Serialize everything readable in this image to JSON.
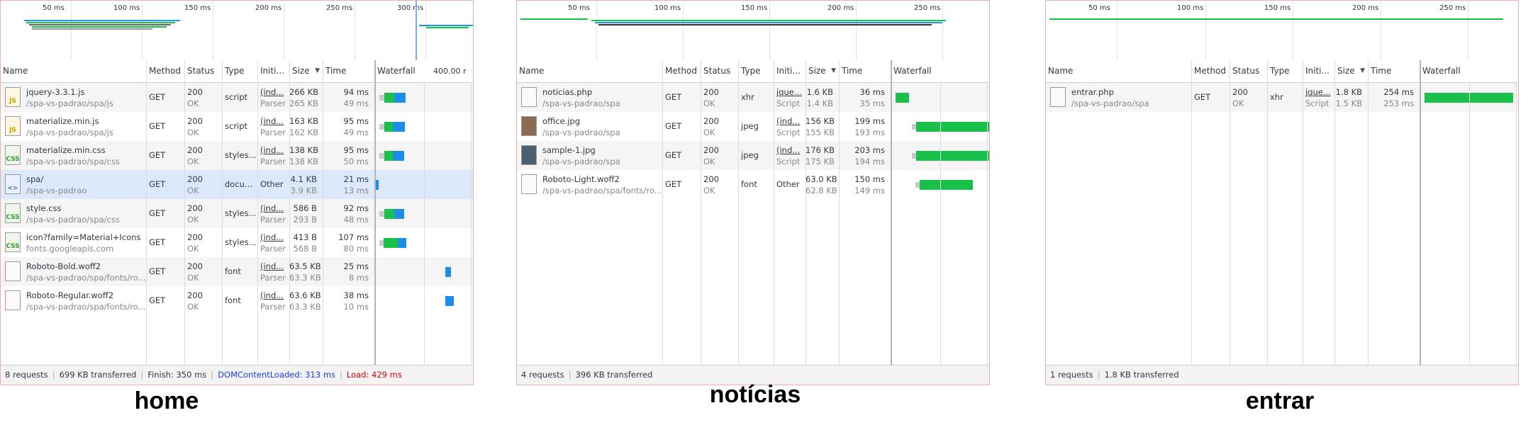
{
  "captions": {
    "home": "home",
    "noticias": "notícias",
    "entrar": "entrar"
  },
  "colors": {
    "waterfall_green": "#19c14a",
    "waterfall_blue": "#1b8ee8",
    "overview_blue": "#1a9ae0",
    "dom_blue": "#1a3edc",
    "load_red": "#d60000"
  },
  "columns": {
    "name": "Name",
    "method": "Method",
    "status": "Status",
    "type": "Type",
    "initiator": "Initi...",
    "size": "Size",
    "time": "Time",
    "waterfall": "Waterfall"
  },
  "home": {
    "overview_ticks": [
      "50 ms",
      "100 ms",
      "150 ms",
      "200 ms",
      "250 ms",
      "300 ms"
    ],
    "waterfall_scale": "400.00 r",
    "rows": [
      {
        "icon": "js-file-icon",
        "badge": "JS",
        "name": "jquery-3.3.1.js",
        "path": "/spa-vs-padrao/spa/js",
        "method": "GET",
        "status": "200",
        "status_text": "OK",
        "type": "script",
        "initiator": "(ind...",
        "initiator_sub": "Parser",
        "size": "266 KB",
        "size_sub": "265 KB",
        "time": "94 ms",
        "time_sub": "49 ms"
      },
      {
        "icon": "js-file-icon",
        "badge": "JS",
        "name": "materialize.min.js",
        "path": "/spa-vs-padrao/spa/js",
        "method": "GET",
        "status": "200",
        "status_text": "OK",
        "type": "script",
        "initiator": "(ind...",
        "initiator_sub": "Parser",
        "size": "163 KB",
        "size_sub": "162 KB",
        "time": "95 ms",
        "time_sub": "49 ms"
      },
      {
        "icon": "css-file-icon",
        "badge": "CSS",
        "name": "materialize.min.css",
        "path": "/spa-vs-padrao/spa/css",
        "method": "GET",
        "status": "200",
        "status_text": "OK",
        "type": "styles...",
        "initiator": "(ind...",
        "initiator_sub": "Parser",
        "size": "138 KB",
        "size_sub": "138 KB",
        "time": "95 ms",
        "time_sub": "50 ms"
      },
      {
        "icon": "document-icon",
        "badge": "<>",
        "name": "spa/",
        "path": "/spa-vs-padrao",
        "method": "GET",
        "status": "200",
        "status_text": "OK",
        "type": "docu...",
        "initiator": "Other",
        "initiator_sub": "",
        "size": "4.1 KB",
        "size_sub": "3.9 KB",
        "time": "21 ms",
        "time_sub": "13 ms"
      },
      {
        "icon": "css-file-icon",
        "badge": "CSS",
        "name": "style.css",
        "path": "/spa-vs-padrao/spa/css",
        "method": "GET",
        "status": "200",
        "status_text": "OK",
        "type": "styles...",
        "initiator": "(ind...",
        "initiator_sub": "Parser",
        "size": "586 B",
        "size_sub": "293 B",
        "time": "92 ms",
        "time_sub": "48 ms"
      },
      {
        "icon": "css-file-icon",
        "badge": "CSS",
        "name": "icon?family=Material+Icons",
        "path": "fonts.googleapis.com",
        "method": "GET",
        "status": "200",
        "status_text": "OK",
        "type": "styles...",
        "initiator": "(ind...",
        "initiator_sub": "Parser",
        "size": "413 B",
        "size_sub": "568 B",
        "time": "107 ms",
        "time_sub": "80 ms"
      },
      {
        "icon": "generic-file-icon",
        "badge": "",
        "name": "Roboto-Bold.woff2",
        "path": "/spa-vs-padrao/spa/fonts/ro...",
        "method": "GET",
        "status": "200",
        "status_text": "OK",
        "type": "font",
        "initiator": "(ind...",
        "initiator_sub": "Parser",
        "size": "63.5 KB",
        "size_sub": "63.3 KB",
        "time": "25 ms",
        "time_sub": "8 ms"
      },
      {
        "icon": "generic-file-icon",
        "badge": "",
        "name": "Roboto-Regular.woff2",
        "path": "/spa-vs-padrao/spa/fonts/ro...",
        "method": "GET",
        "status": "200",
        "status_text": "OK",
        "type": "font",
        "initiator": "(ind...",
        "initiator_sub": "Parser",
        "size": "63.6 KB",
        "size_sub": "63.3 KB",
        "time": "38 ms",
        "time_sub": "10 ms"
      }
    ],
    "footer": {
      "requests": "8 requests",
      "transferred": "699 KB transferred",
      "finish": "Finish: 350 ms",
      "domcontentloaded": "DOMContentLoaded: 313 ms",
      "load": "Load: 429 ms"
    }
  },
  "noticias": {
    "overview_ticks": [
      "50 ms",
      "100 ms",
      "150 ms",
      "200 ms",
      "250 ms"
    ],
    "rows": [
      {
        "icon": "generic-file-icon",
        "badge": "",
        "name": "noticias.php",
        "path": "/spa-vs-padrao/spa",
        "method": "GET",
        "status": "200",
        "status_text": "OK",
        "type": "xhr",
        "initiator": "jque...",
        "initiator_sub": "Script",
        "size": "1.6 KB",
        "size_sub": "1.4 KB",
        "time": "36 ms",
        "time_sub": "35 ms"
      },
      {
        "icon": "image-file-icon",
        "badge": "",
        "name": "office.jpg",
        "path": "/spa-vs-padrao/spa",
        "method": "GET",
        "status": "200",
        "status_text": "OK",
        "type": "jpeg",
        "initiator": "(ind...",
        "initiator_sub": "Script",
        "size": "156 KB",
        "size_sub": "155 KB",
        "time": "199 ms",
        "time_sub": "193 ms"
      },
      {
        "icon": "image-file-icon",
        "badge": "",
        "name": "sample-1.jpg",
        "path": "/spa-vs-padrao/spa",
        "method": "GET",
        "status": "200",
        "status_text": "OK",
        "type": "jpeg",
        "initiator": "(ind...",
        "initiator_sub": "Script",
        "size": "176 KB",
        "size_sub": "175 KB",
        "time": "203 ms",
        "time_sub": "194 ms"
      },
      {
        "icon": "generic-file-icon",
        "badge": "",
        "name": "Roboto-Light.woff2",
        "path": "/spa-vs-padrao/spa/fonts/ro...",
        "method": "GET",
        "status": "200",
        "status_text": "OK",
        "type": "font",
        "initiator": "Other",
        "initiator_sub": "",
        "size": "63.0 KB",
        "size_sub": "62.8 KB",
        "time": "150 ms",
        "time_sub": "149 ms"
      }
    ],
    "footer": {
      "requests": "4 requests",
      "transferred": "396 KB transferred"
    }
  },
  "entrar": {
    "overview_ticks": [
      "50 ms",
      "100 ms",
      "150 ms",
      "200 ms",
      "250 ms"
    ],
    "rows": [
      {
        "icon": "generic-file-icon",
        "badge": "",
        "name": "entrar.php",
        "path": "/spa-vs-padrao/spa",
        "method": "GET",
        "status": "200",
        "status_text": "OK",
        "type": "xhr",
        "initiator": "jque...",
        "initiator_sub": "Script",
        "size": "1.8 KB",
        "size_sub": "1.5 KB",
        "time": "254 ms",
        "time_sub": "253 ms"
      }
    ],
    "footer": {
      "requests": "1 requests",
      "transferred": "1.8 KB transferred"
    }
  }
}
